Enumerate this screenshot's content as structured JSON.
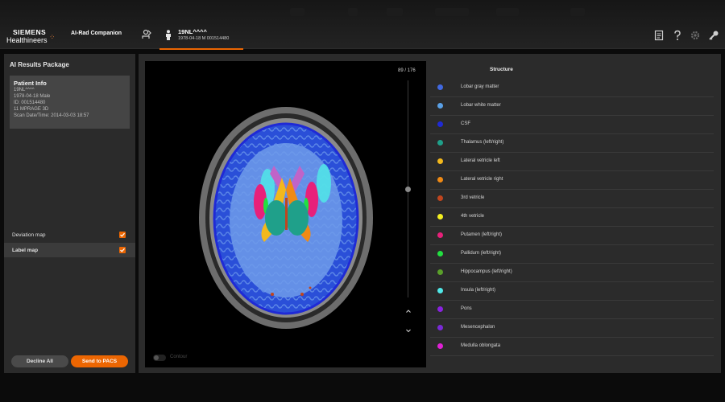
{
  "header": {
    "logo_line1": "SIEMENS",
    "logo_line2": "Healthineers",
    "app_title": "AI-Rad Companion",
    "patient_tab": {
      "name": "19NL^^^^",
      "info": "1978-04-18 M 001514480"
    }
  },
  "left_panel": {
    "title": "AI Results Package",
    "patient_info": {
      "header": "Patient Info",
      "lines": [
        "19NL^^^^",
        "1978-04-18 Male",
        "ID: 001514480",
        "11 MPRAGE 3D",
        "Scan Date/Time: 2014-03-03 18:57"
      ]
    },
    "options": [
      {
        "label": "Deviation map",
        "checked": true
      },
      {
        "label": "Label map",
        "checked": true
      }
    ],
    "decline_label": "Decline All",
    "send_label": "Send to PACS"
  },
  "viewer": {
    "slice_counter": "89 / 176",
    "slice_position_fraction": 0.5,
    "contour_label": "Contour",
    "contour_enabled": false
  },
  "structure_list": {
    "header": "Structure",
    "items": [
      {
        "name": "Lobar gray matter",
        "color": "#4169e1"
      },
      {
        "name": "Lobar white matter",
        "color": "#5aa0e6"
      },
      {
        "name": "CSF",
        "color": "#1f2ad6"
      },
      {
        "name": "Thalamus (left/right)",
        "color": "#1fa08a"
      },
      {
        "name": "Lateral vetricle left",
        "color": "#f3b81c"
      },
      {
        "name": "Lateral vetricle right",
        "color": "#f08a14"
      },
      {
        "name": "3rd vetricle",
        "color": "#c0451e"
      },
      {
        "name": "4th vetricle",
        "color": "#f4f020"
      },
      {
        "name": "Putamen (left/right)",
        "color": "#e8207a"
      },
      {
        "name": "Pallidum (left/right)",
        "color": "#22e040"
      },
      {
        "name": "Hippocampus (left/right)",
        "color": "#5aa02a"
      },
      {
        "name": "Insula (left/right)",
        "color": "#50e8e8"
      },
      {
        "name": "Pons",
        "color": "#8a22e0"
      },
      {
        "name": "Mesencephalon",
        "color": "#7a2ad6"
      },
      {
        "name": "Medulla oblongata",
        "color": "#e020d6"
      }
    ]
  },
  "colors": {
    "accent": "#ec6602",
    "panel": "#2b2b2b"
  }
}
